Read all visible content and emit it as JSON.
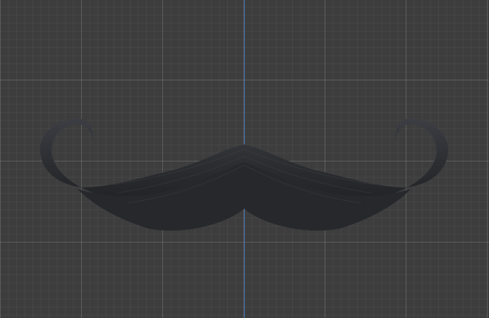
{
  "viewport": {
    "background_color": "#3d3d3d",
    "grid_major_color": "#5a5a5a",
    "grid_minor_color": "#454545",
    "axis_color": "#3f6fb4"
  },
  "object": {
    "name_icon": "mustache-mesh",
    "color_dark": "#1e1f22",
    "color_mid": "#2b2d31",
    "color_light": "#3e4046"
  }
}
